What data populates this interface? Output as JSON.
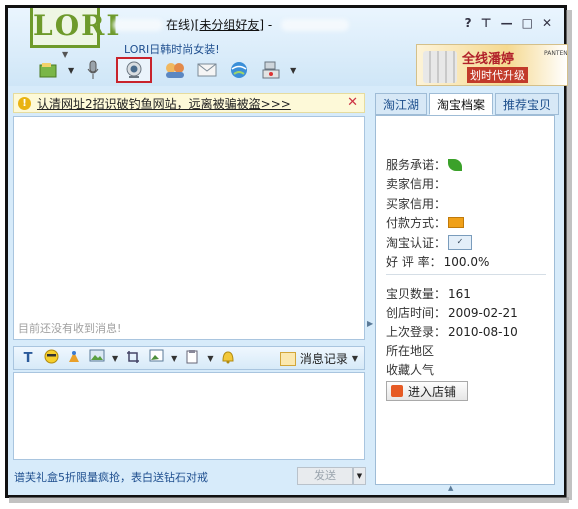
{
  "header": {
    "logo_text": "LORI",
    "status_text": "在线)[",
    "group_text": "未分组好友",
    "status_tail": "]  -",
    "signature": "LORI日韩时尚女装!",
    "window_controls": [
      "?",
      "⊤",
      "—",
      "□",
      "✕"
    ],
    "ad_line1": "全线潘婷",
    "ad_line2": "划时代升级",
    "ad_brand": "PANTENE"
  },
  "toolbar": {
    "icons": [
      "transfer-file-icon",
      "voice-icon",
      "video-icon",
      "group-icon",
      "email-icon",
      "browser-icon",
      "app-icon"
    ]
  },
  "notice": {
    "text": "认清网址2招识破钓鱼网站，远离被骗被盗>>>",
    "close": "✕"
  },
  "chat": {
    "empty_text": "目前还没有收到消息!"
  },
  "input_toolbar": {
    "history_label": "消息记录"
  },
  "footer": {
    "ad_text": "谱芙礼盒5折限量疯抢，表白送钻石对戒",
    "send_label": "发送"
  },
  "right_panel": {
    "tabs": [
      "淘江湖",
      "淘宝档案",
      "推荐宝贝"
    ],
    "service_label": "服务承诺：",
    "seller_credit_label": "卖家信用：",
    "buyer_credit_label": "买家信用：",
    "payment_label": "付款方式：",
    "cert_label": "淘宝认证：",
    "rating_label": "好 评 率：",
    "rating_value": "100.0%",
    "items_label": "宝贝数量：",
    "items_value": "161",
    "created_label": "创店时间：",
    "created_value": "2009-02-21",
    "last_login_label": "上次登录：",
    "last_login_value": "2010-08-10",
    "region_label": "所在地区",
    "popularity_label": "收藏人气",
    "enter_shop": "进入店铺"
  }
}
